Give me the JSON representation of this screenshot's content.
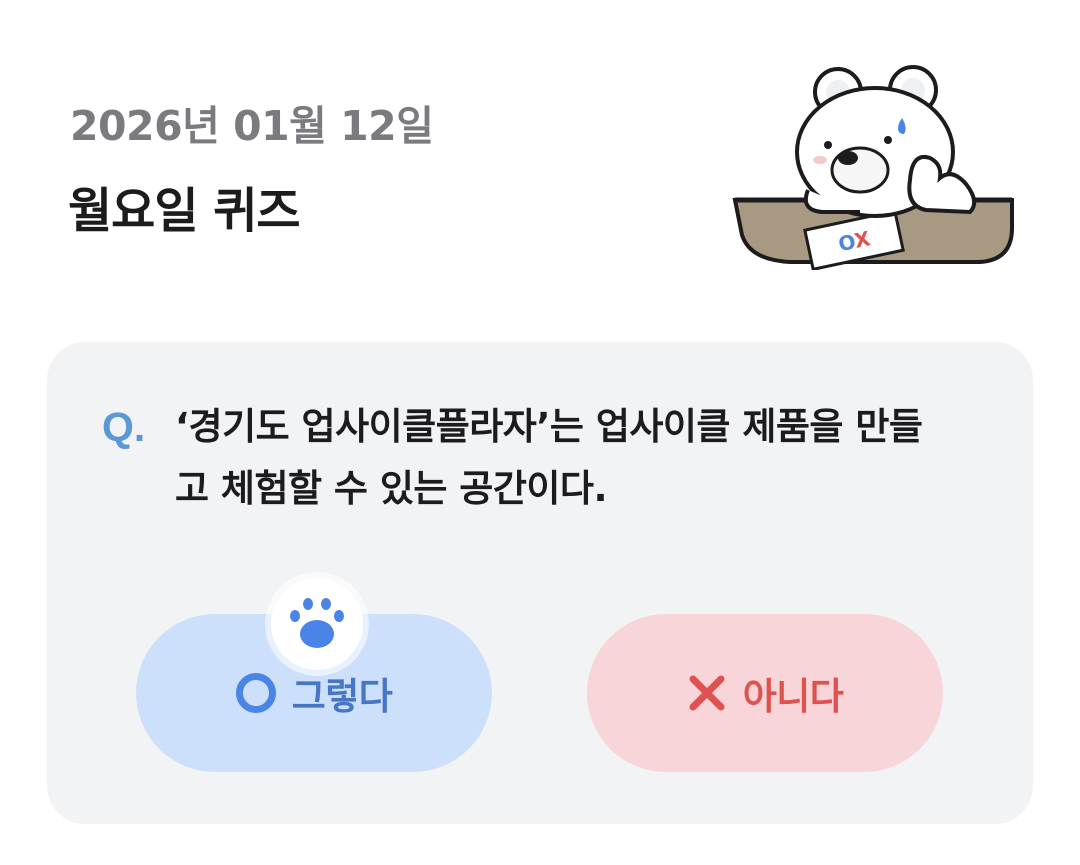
{
  "header": {
    "date": "2026년 01월 12일",
    "title": "월요일 퀴즈"
  },
  "mascot": {
    "icon": "polar-bear-quiz-mascot",
    "paper_text": "OX"
  },
  "quiz": {
    "q_mark": "Q.",
    "question": "‘경기도 업사이클플라자’는 업사이클 제품을 만들고 체험할 수 있는 공간이다.",
    "options": [
      {
        "id": "yes",
        "label": "그렇다",
        "icon": "circle-o-icon",
        "color": "#4a84e6"
      },
      {
        "id": "no",
        "label": "아니다",
        "icon": "x-icon",
        "color": "#e0524f"
      }
    ],
    "paw_icon": "paw-icon"
  },
  "colors": {
    "card_bg": "#f2f3f5",
    "yes_bg": "#cde0fb",
    "no_bg": "#f7d5d8",
    "q_mark": "#5a98d6"
  }
}
